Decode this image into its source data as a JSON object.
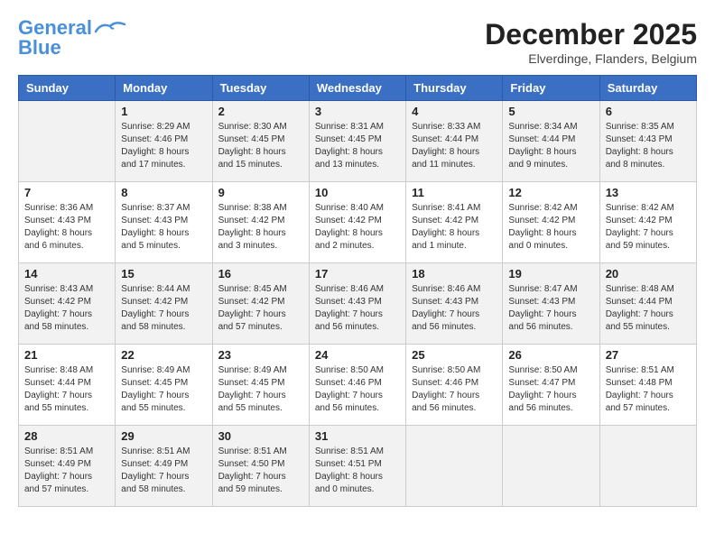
{
  "header": {
    "logo_line1": "General",
    "logo_line2": "Blue",
    "month": "December 2025",
    "location": "Elverdinge, Flanders, Belgium"
  },
  "days_of_week": [
    "Sunday",
    "Monday",
    "Tuesday",
    "Wednesday",
    "Thursday",
    "Friday",
    "Saturday"
  ],
  "weeks": [
    [
      {
        "day": "",
        "sunrise": "",
        "sunset": "",
        "daylight": ""
      },
      {
        "day": "1",
        "sunrise": "Sunrise: 8:29 AM",
        "sunset": "Sunset: 4:46 PM",
        "daylight": "Daylight: 8 hours and 17 minutes."
      },
      {
        "day": "2",
        "sunrise": "Sunrise: 8:30 AM",
        "sunset": "Sunset: 4:45 PM",
        "daylight": "Daylight: 8 hours and 15 minutes."
      },
      {
        "day": "3",
        "sunrise": "Sunrise: 8:31 AM",
        "sunset": "Sunset: 4:45 PM",
        "daylight": "Daylight: 8 hours and 13 minutes."
      },
      {
        "day": "4",
        "sunrise": "Sunrise: 8:33 AM",
        "sunset": "Sunset: 4:44 PM",
        "daylight": "Daylight: 8 hours and 11 minutes."
      },
      {
        "day": "5",
        "sunrise": "Sunrise: 8:34 AM",
        "sunset": "Sunset: 4:44 PM",
        "daylight": "Daylight: 8 hours and 9 minutes."
      },
      {
        "day": "6",
        "sunrise": "Sunrise: 8:35 AM",
        "sunset": "Sunset: 4:43 PM",
        "daylight": "Daylight: 8 hours and 8 minutes."
      }
    ],
    [
      {
        "day": "7",
        "sunrise": "Sunrise: 8:36 AM",
        "sunset": "Sunset: 4:43 PM",
        "daylight": "Daylight: 8 hours and 6 minutes."
      },
      {
        "day": "8",
        "sunrise": "Sunrise: 8:37 AM",
        "sunset": "Sunset: 4:43 PM",
        "daylight": "Daylight: 8 hours and 5 minutes."
      },
      {
        "day": "9",
        "sunrise": "Sunrise: 8:38 AM",
        "sunset": "Sunset: 4:42 PM",
        "daylight": "Daylight: 8 hours and 3 minutes."
      },
      {
        "day": "10",
        "sunrise": "Sunrise: 8:40 AM",
        "sunset": "Sunset: 4:42 PM",
        "daylight": "Daylight: 8 hours and 2 minutes."
      },
      {
        "day": "11",
        "sunrise": "Sunrise: 8:41 AM",
        "sunset": "Sunset: 4:42 PM",
        "daylight": "Daylight: 8 hours and 1 minute."
      },
      {
        "day": "12",
        "sunrise": "Sunrise: 8:42 AM",
        "sunset": "Sunset: 4:42 PM",
        "daylight": "Daylight: 8 hours and 0 minutes."
      },
      {
        "day": "13",
        "sunrise": "Sunrise: 8:42 AM",
        "sunset": "Sunset: 4:42 PM",
        "daylight": "Daylight: 7 hours and 59 minutes."
      }
    ],
    [
      {
        "day": "14",
        "sunrise": "Sunrise: 8:43 AM",
        "sunset": "Sunset: 4:42 PM",
        "daylight": "Daylight: 7 hours and 58 minutes."
      },
      {
        "day": "15",
        "sunrise": "Sunrise: 8:44 AM",
        "sunset": "Sunset: 4:42 PM",
        "daylight": "Daylight: 7 hours and 58 minutes."
      },
      {
        "day": "16",
        "sunrise": "Sunrise: 8:45 AM",
        "sunset": "Sunset: 4:42 PM",
        "daylight": "Daylight: 7 hours and 57 minutes."
      },
      {
        "day": "17",
        "sunrise": "Sunrise: 8:46 AM",
        "sunset": "Sunset: 4:43 PM",
        "daylight": "Daylight: 7 hours and 56 minutes."
      },
      {
        "day": "18",
        "sunrise": "Sunrise: 8:46 AM",
        "sunset": "Sunset: 4:43 PM",
        "daylight": "Daylight: 7 hours and 56 minutes."
      },
      {
        "day": "19",
        "sunrise": "Sunrise: 8:47 AM",
        "sunset": "Sunset: 4:43 PM",
        "daylight": "Daylight: 7 hours and 56 minutes."
      },
      {
        "day": "20",
        "sunrise": "Sunrise: 8:48 AM",
        "sunset": "Sunset: 4:44 PM",
        "daylight": "Daylight: 7 hours and 55 minutes."
      }
    ],
    [
      {
        "day": "21",
        "sunrise": "Sunrise: 8:48 AM",
        "sunset": "Sunset: 4:44 PM",
        "daylight": "Daylight: 7 hours and 55 minutes."
      },
      {
        "day": "22",
        "sunrise": "Sunrise: 8:49 AM",
        "sunset": "Sunset: 4:45 PM",
        "daylight": "Daylight: 7 hours and 55 minutes."
      },
      {
        "day": "23",
        "sunrise": "Sunrise: 8:49 AM",
        "sunset": "Sunset: 4:45 PM",
        "daylight": "Daylight: 7 hours and 55 minutes."
      },
      {
        "day": "24",
        "sunrise": "Sunrise: 8:50 AM",
        "sunset": "Sunset: 4:46 PM",
        "daylight": "Daylight: 7 hours and 56 minutes."
      },
      {
        "day": "25",
        "sunrise": "Sunrise: 8:50 AM",
        "sunset": "Sunset: 4:46 PM",
        "daylight": "Daylight: 7 hours and 56 minutes."
      },
      {
        "day": "26",
        "sunrise": "Sunrise: 8:50 AM",
        "sunset": "Sunset: 4:47 PM",
        "daylight": "Daylight: 7 hours and 56 minutes."
      },
      {
        "day": "27",
        "sunrise": "Sunrise: 8:51 AM",
        "sunset": "Sunset: 4:48 PM",
        "daylight": "Daylight: 7 hours and 57 minutes."
      }
    ],
    [
      {
        "day": "28",
        "sunrise": "Sunrise: 8:51 AM",
        "sunset": "Sunset: 4:49 PM",
        "daylight": "Daylight: 7 hours and 57 minutes."
      },
      {
        "day": "29",
        "sunrise": "Sunrise: 8:51 AM",
        "sunset": "Sunset: 4:49 PM",
        "daylight": "Daylight: 7 hours and 58 minutes."
      },
      {
        "day": "30",
        "sunrise": "Sunrise: 8:51 AM",
        "sunset": "Sunset: 4:50 PM",
        "daylight": "Daylight: 7 hours and 59 minutes."
      },
      {
        "day": "31",
        "sunrise": "Sunrise: 8:51 AM",
        "sunset": "Sunset: 4:51 PM",
        "daylight": "Daylight: 8 hours and 0 minutes."
      },
      {
        "day": "",
        "sunrise": "",
        "sunset": "",
        "daylight": ""
      },
      {
        "day": "",
        "sunrise": "",
        "sunset": "",
        "daylight": ""
      },
      {
        "day": "",
        "sunrise": "",
        "sunset": "",
        "daylight": ""
      }
    ]
  ]
}
